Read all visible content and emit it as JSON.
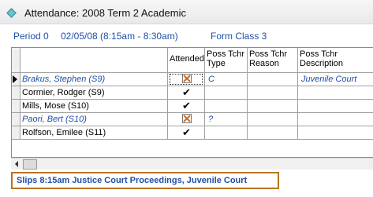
{
  "window": {
    "title": "Attendance: 2008 Term 2 Academic",
    "icon": "attendance-app-icon"
  },
  "info": {
    "period": "Period 0",
    "date_time": "02/05/08 (8:15am - 8:30am)",
    "form_class": "Form Class 3"
  },
  "grid": {
    "columns": {
      "attended": "Attended",
      "type": "Poss Tchr Type",
      "reason": "Poss Tchr Reason",
      "description": "Poss Tchr Description"
    },
    "rows": [
      {
        "name": "Brakus, Stephen (S9)",
        "attended": "absent",
        "type": "C",
        "reason": "",
        "description": "Juvenile Court"
      },
      {
        "name": "Cormier, Rodger (S9)",
        "attended": "present",
        "type": "",
        "reason": "",
        "description": ""
      },
      {
        "name": "Mills, Mose (S10)",
        "attended": "present",
        "type": "",
        "reason": "",
        "description": ""
      },
      {
        "name": "Paori, Bert (S10)",
        "attended": "absent",
        "type": "?",
        "reason": "",
        "description": ""
      },
      {
        "name": "Rolfson, Emilee (S11)",
        "attended": "present",
        "type": "",
        "reason": "",
        "description": ""
      }
    ]
  },
  "slip": {
    "text": "Slips 8:15am Justice Court Proceedings, Juvenile Court"
  },
  "colors": {
    "accent_text": "#1f4fa8",
    "slip_border": "#b7741f",
    "absent_mark": "#d46a1a"
  }
}
